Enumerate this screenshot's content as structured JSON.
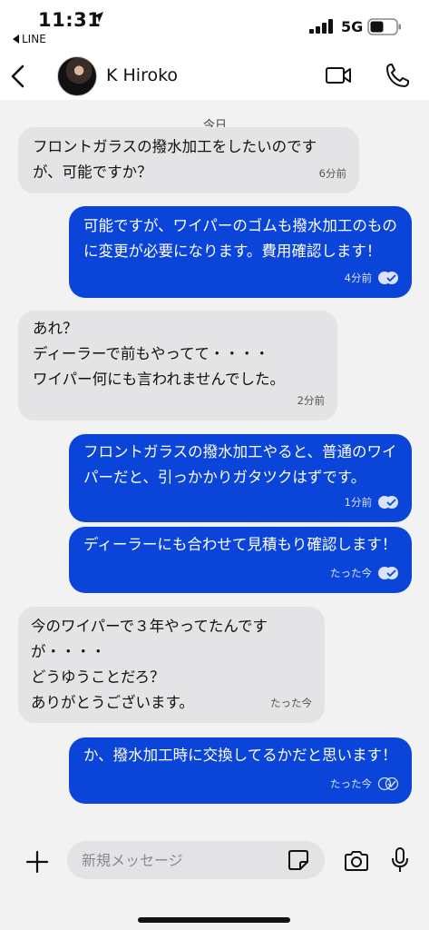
{
  "status": {
    "time": "11:31",
    "back_app": "LINE",
    "network": "5G"
  },
  "header": {
    "contact_name": "K Hiroko"
  },
  "chat": {
    "date_label": "今日",
    "messages": [
      {
        "dir": "in",
        "text": "フロントガラスの撥水加工をしたいのですが、可能ですか？",
        "time": "6分前"
      },
      {
        "dir": "out",
        "text": "可能ですが、ワイパーのゴムも撥水加工のものに変更が必要になります。費用確認します！",
        "time": "4分前"
      },
      {
        "dir": "in",
        "text": "あれ？\nディーラーで前もやってて・・・・\nワイパー何にも言われませんでした。",
        "time": "2分前"
      },
      {
        "dir": "out",
        "text": "フロントガラスの撥水加工やると、普通のワイパーだと、引っかかりガタツクはずです。",
        "time": "1分前"
      },
      {
        "dir": "out",
        "text": "ディーラーにも合わせて見積もり確認します！",
        "time": "たった今"
      },
      {
        "dir": "in",
        "text": "今のワイパーで３年やってたんですが・・・・\nどうゆうことだろ？\nありがとうございます。",
        "time": "たった今"
      },
      {
        "dir": "out",
        "text": "か、撥水加工時に交換してるかだと思います！",
        "time": "たった今"
      }
    ]
  },
  "composer": {
    "placeholder": "新規メッセージ"
  },
  "colors": {
    "outgoing_bubble": "#0a44d9",
    "incoming_bubble": "#e4e4e6",
    "background": "#f2f2f3"
  }
}
